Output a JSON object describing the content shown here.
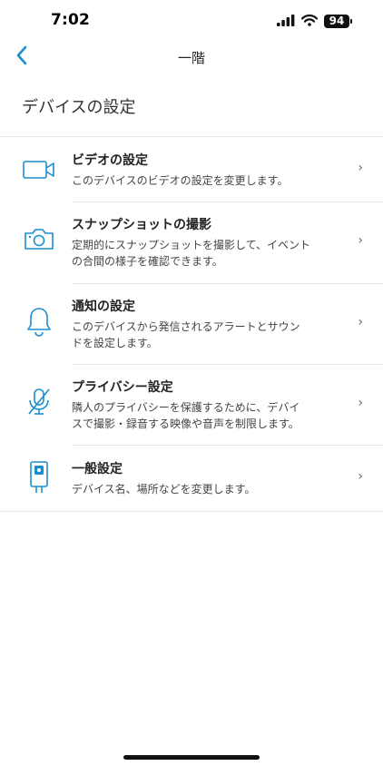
{
  "status_bar": {
    "time": "7:02",
    "battery": "94"
  },
  "nav": {
    "title": "一階",
    "back_icon": "chevron-left-icon"
  },
  "section": {
    "title": "デバイスの設定"
  },
  "settings": [
    {
      "icon": "video-camera-icon",
      "title": "ビデオの設定",
      "desc1": "このデバイスのビデオの設定を変更します。",
      "desc2": ""
    },
    {
      "icon": "camera-icon",
      "title": "スナップショットの撮影",
      "desc1": "定期的にスナップショットを撮影して、イベント",
      "desc2": "の合間の様子を確認できます。"
    },
    {
      "icon": "bell-icon",
      "title": "通知の設定",
      "desc1": "このデバイスから発信されるアラートとサウン",
      "desc2": "ドを設定します。"
    },
    {
      "icon": "mic-off-icon",
      "title": "プライバシー設定",
      "desc1": "隣人のプライバシーを保護するために、デバイ",
      "desc2": "スで撮影・録音する映像や音声を制限します。"
    },
    {
      "icon": "device-icon",
      "title": "一般設定",
      "desc1": "デバイス名、場所などを変更します。",
      "desc2": ""
    }
  ],
  "colors": {
    "accent": "#1a8fd0",
    "divider": "#e6e6e6"
  }
}
